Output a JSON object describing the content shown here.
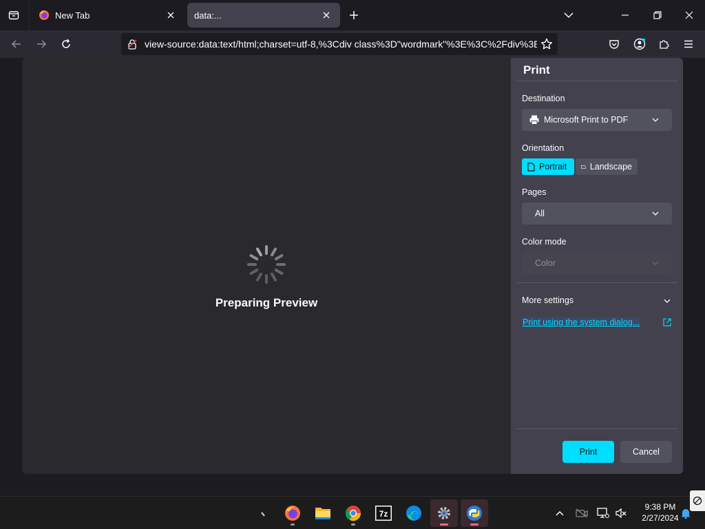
{
  "tabs": [
    {
      "label": "New Tab",
      "icon": "firefox-icon"
    },
    {
      "label": "data:...",
      "icon": ""
    }
  ],
  "navbar": {
    "url": "view-source:data:text/html;charset=utf-8,%3Cdiv class%3D\"wordmark\"%3E%3C%2Fdiv%3E"
  },
  "preview": {
    "status": "Preparing Preview"
  },
  "print_panel": {
    "title": "Print",
    "destination_label": "Destination",
    "destination_value": "Microsoft Print to PDF",
    "orientation_label": "Orientation",
    "portrait_label": "Portrait",
    "landscape_label": "Landscape",
    "pages_label": "Pages",
    "pages_value": "All",
    "color_mode_label": "Color mode",
    "color_mode_value": "Color",
    "more_settings_label": "More settings",
    "system_dialog_link": "Print using the system dialog...",
    "print_button": "Print",
    "cancel_button": "Cancel"
  },
  "taskbar": {
    "apps": [
      "search-icon",
      "firefox-icon",
      "file-explorer-icon",
      "chrome-icon",
      "7zip-icon",
      "edge-icon",
      "settings-icon",
      "python-icon"
    ],
    "time": "9:38 PM",
    "date": "2/27/2024"
  },
  "colors": {
    "accent": "#00ddff",
    "panel_bg": "#42414d",
    "preview_bg": "#2a2a2e",
    "chrome_bg": "#1c1b22"
  }
}
